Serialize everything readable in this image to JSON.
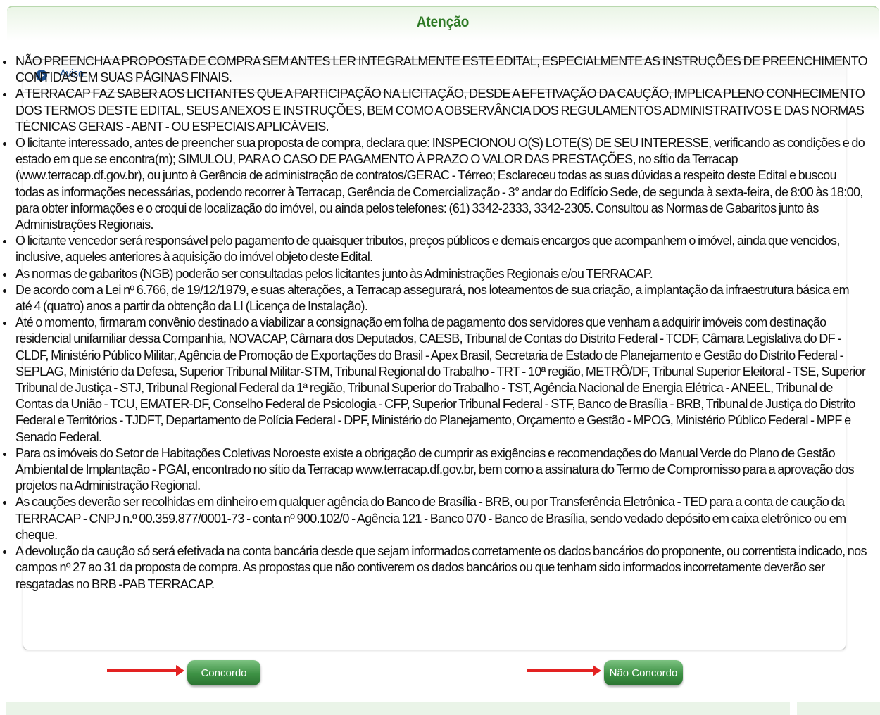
{
  "header": {
    "title": "Atenção"
  },
  "panel": {
    "heading": "Aviso",
    "items": [
      "NÃO PREENCHA A PROPOSTA DE COMPRA SEM ANTES LER INTEGRALMENTE ESTE EDITAL, ESPECIALMENTE AS INSTRUÇÕES DE PREENCHIMENTO CONTIDAS EM SUAS PÁGINAS FINAIS.",
      "A TERRACAP FAZ SABER AOS LICITANTES QUE A PARTICIPAÇÃO NA LICITAÇÃO, DESDE A EFETIVAÇÃO DA CAUÇÃO, IMPLICA PLENO CONHECIMENTO DOS TERMOS DESTE EDITAL, SEUS ANEXOS E INSTRUÇÕES, BEM COMO A OBSERVÂNCIA DOS REGULAMENTOS ADMINISTRATIVOS E DAS NORMAS TÉCNICAS GERAIS - ABNT - OU ESPECIAIS APLICÁVEIS.",
      "O licitante interessado, antes de preencher sua proposta de compra, declara que: INSPECIONOU O(S) LOTE(S) DE SEU INTERESSE, verificando as condições e do estado em que se encontra(m); SIMULOU, PARA O CASO DE PAGAMENTO À PRAZO O VALOR DAS PRESTAÇÕES, no sítio da Terracap (www.terracap.df.gov.br), ou junto à Gerência de administração de contratos/GERAC - Térreo; Esclareceu todas as suas dúvidas a respeito deste Edital e buscou todas as informações necessárias, podendo recorrer à Terracap, Gerência de Comercialização - 3° andar do Edifício Sede, de segunda à sexta-feira, de 8:00 às 18:00, para obter informações e o croqui de localização do imóvel, ou ainda pelos telefones: (61) 3342-2333, 3342-2305. Consultou as Normas de Gabaritos junto às Administrações Regionais.",
      "O licitante vencedor será responsável pelo pagamento de quaisquer tributos, preços públicos e demais encargos que acompanhem o imóvel, ainda que vencidos, inclusive, aqueles anteriores à aquisição do imóvel objeto deste Edital.",
      "As normas de gabaritos (NGB) poderão ser consultadas pelos licitantes junto às Administrações Regionais e/ou TERRACAP.",
      "De acordo com a Lei nº 6.766, de 19/12/1979, e suas alterações, a Terracap assegurará, nos loteamentos de sua criação, a implantação da infraestrutura básica em até 4 (quatro) anos a partir da obtenção da LI (Licença de Instalação).",
      "Até o momento, firmaram convênio destinado a viabilizar a consignação em folha de pagamento dos servidores que venham a adquirir imóveis com destinação residencial unifamiliar dessa Companhia, NOVACAP, Câmara dos Deputados, CAESB, Tribunal de Contas do Distrito Federal - TCDF, Câmara Legislativa do DF - CLDF, Ministério Público Militar, Agência de Promoção de Exportações do Brasil - Apex Brasil, Secretaria de Estado de Planejamento e Gestão do Distrito Federal - SEPLAG, Ministério da Defesa, Superior Tribunal Militar-STM, Tribunal Regional do Trabalho - TRT - 10ª região, METRÔ/DF, Tribunal Superior Eleitoral - TSE, Superior Tribunal de Justiça - STJ, Tribunal Regional Federal da 1ª região, Tribunal Superior do Trabalho - TST, Agência Nacional de Energia Elétrica - ANEEL, Tribunal de Contas da União - TCU, EMATER-DF, Conselho Federal de Psicologia - CFP, Superior Tribunal Federal - STF, Banco de Brasília - BRB, Tribunal de Justiça do Distrito Federal e Territórios - TJDFT, Departamento de Polícia Federal - DPF, Ministério do Planejamento, Orçamento e Gestão - MPOG, Ministério Público Federal - MPF e Senado Federal.",
      "Para os imóveis do Setor de Habitações Coletivas Noroeste existe a obrigação de cumprir as exigências e recomendações do Manual Verde do Plano de Gestão Ambiental de Implantação - PGAI, encontrado no sítio da Terracap www.terracap.df.gov.br, bem como a assinatura do Termo de Compromisso para a aprovação dos projetos na Administração Regional.",
      "As cauções deverão ser recolhidas em dinheiro em qualquer agência do Banco de Brasília - BRB, ou por Transferência Eletrônica - TED para a conta de caução da TERRACAP - CNPJ n.º 00.359.877/0001-73 - conta nº 900.102/0 - Agência 121 - Banco 070 - Banco de Brasília, sendo vedado depósito em caixa eletrônico ou em cheque.",
      "A devolução da caução só será efetivada na conta bancária desde que sejam informados corretamente os dados bancários do proponente, ou correntista indicado, nos campos nº 27 ao 31 da proposta de compra. As propostas que não contiverem os dados bancários ou que tenham sido informados incorretamente deverão ser resgatadas no BRB -PAB TERRACAP."
    ]
  },
  "buttons": {
    "agree": "Concordo",
    "disagree": "Não Concordo"
  },
  "colors": {
    "title": "#2e7a25",
    "button": "#3d9144",
    "arrow": "#e32222",
    "aviso": "#1d4f8e"
  }
}
